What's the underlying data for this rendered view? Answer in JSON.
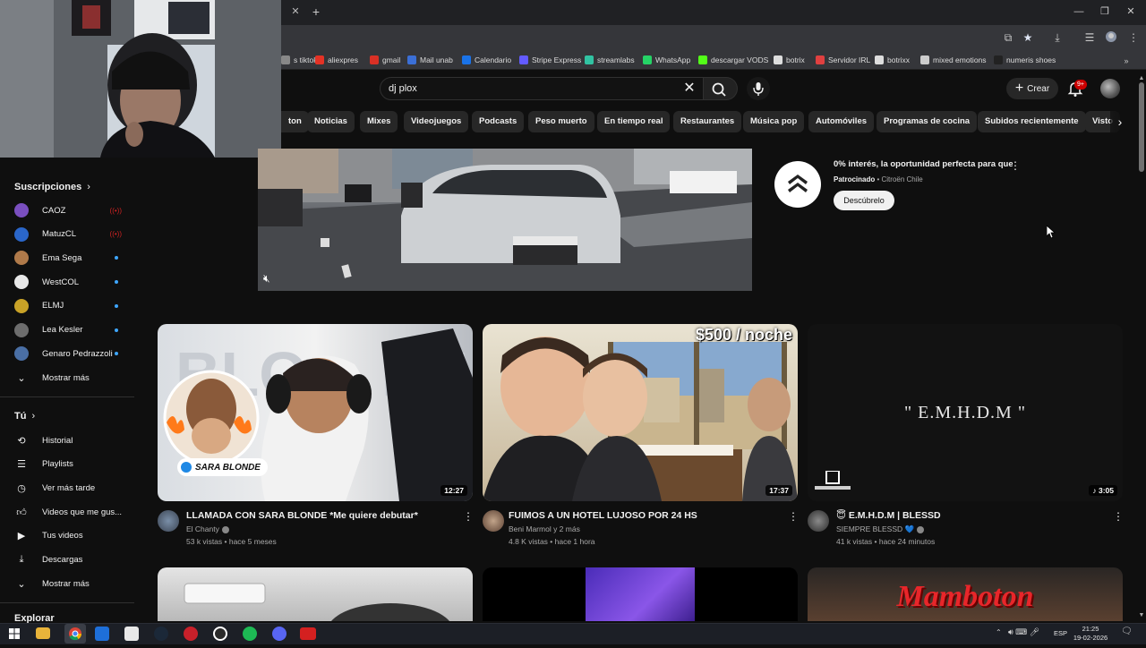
{
  "browser": {
    "bookmarks": [
      {
        "label": "s tiktok",
        "color": "#888888"
      },
      {
        "label": "aliexpres",
        "color": "#e43225"
      },
      {
        "label": "gmail",
        "color": "#d93025"
      },
      {
        "label": "Mail unab",
        "color": "#3b6fd6"
      },
      {
        "label": "Calendario",
        "color": "#1a73e8"
      },
      {
        "label": "Stripe Express",
        "color": "#635bff"
      },
      {
        "label": "streamlabs",
        "color": "#31c3a2"
      },
      {
        "label": "WhatsApp",
        "color": "#25d366"
      },
      {
        "label": "descargar VODS",
        "color": "#53fc18"
      },
      {
        "label": "botrix",
        "color": "#dddddd"
      },
      {
        "label": "Servidor IRL",
        "color": "#e04040"
      },
      {
        "label": "botrixx",
        "color": "#dddddd"
      },
      {
        "label": "mixed emotions",
        "color": "#cccccc"
      },
      {
        "label": "numeris shoes",
        "color": "#222222"
      }
    ]
  },
  "header": {
    "search_value": "dj plox",
    "create_label": "Crear",
    "notifications_badge": "9+"
  },
  "chips": [
    "ton",
    "Noticias",
    "Mixes",
    "Videojuegos",
    "Podcasts",
    "Peso muerto",
    "En tiempo real",
    "Restaurantes",
    "Música pop",
    "Automóviles",
    "Programas de cocina",
    "Subidos recientemente",
    "Visto"
  ],
  "sidebar": {
    "subscriptions_title": "Suscripciones",
    "subscriptions": [
      {
        "name": "CAOZ",
        "status": "live",
        "color": "#7a4fbf"
      },
      {
        "name": "MatuzCL",
        "status": "live",
        "color": "#2a66c9"
      },
      {
        "name": "Ema Sega",
        "status": "new",
        "color": "#b07a4a"
      },
      {
        "name": "WestCOL",
        "status": "new",
        "color": "#e8e8e8"
      },
      {
        "name": "ELMJ",
        "status": "new",
        "color": "#c9a227"
      },
      {
        "name": "Lea Kesler",
        "status": "new",
        "color": "#6d6d6d"
      },
      {
        "name": "Genaro Pedrazzoli",
        "status": "new",
        "color": "#4a6fa5"
      }
    ],
    "show_more_subs": "Mostrar más",
    "you_title": "Tú",
    "you_items": [
      {
        "label": "Historial",
        "icon": "history-icon"
      },
      {
        "label": "Playlists",
        "icon": "playlists-icon"
      },
      {
        "label": "Ver más tarde",
        "icon": "watch-later-icon"
      },
      {
        "label": "Videos que me gus...",
        "icon": "liked-icon"
      },
      {
        "label": "Tus videos",
        "icon": "your-videos-icon"
      },
      {
        "label": "Descargas",
        "icon": "downloads-icon"
      }
    ],
    "show_more_you": "Mostrar más",
    "explore_title": "Explorar"
  },
  "ad": {
    "title": "0% interés, la oportunidad perfecta para que ...",
    "sponsored": "Patrocinado",
    "advertiser": "Citroën Chile",
    "cta": "Descúbrelo"
  },
  "videos": [
    {
      "title": "LLAMADA CON SARA BLONDE *Me quiere debutar*",
      "channel": "El Chanty",
      "meta": "53 k vistas • hace 5 meses",
      "duration": "12:27",
      "thumb_caption": "SARA BLONDE"
    },
    {
      "title": "FUIMOS A UN HOTEL LUJOSO POR 24 HS",
      "channel": "Beni Marmol y 2 más",
      "meta": "4.8 K vistas • hace 1 hora",
      "duration": "17:37",
      "thumb_caption": "$500 / noche"
    },
    {
      "title": "😇 E.M.H.D.M | BLESSD",
      "channel": "SIEMPRE BLESSD 💙",
      "meta": "41 k vistas • hace 24 minutos",
      "duration": "3:05",
      "thumb_caption": "\" E.M.H.D.M \""
    }
  ],
  "row2_caption": "Mamboton",
  "taskbar": {
    "lang": "ESP",
    "time": "21:25",
    "date": "19-02-2026"
  }
}
